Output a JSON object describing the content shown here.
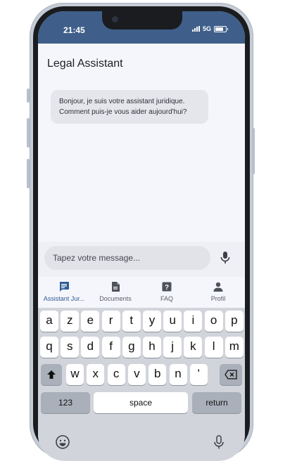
{
  "status_bar": {
    "time": "21:45",
    "network": "5G"
  },
  "app": {
    "title": "Legal Assistant"
  },
  "chat": {
    "messages": [
      {
        "sender": "assistant",
        "text": "Bonjour, je suis votre assistant juridique. Comment puis-je vous aider aujourd'hui?"
      }
    ]
  },
  "composer": {
    "placeholder": "Tapez votre message...",
    "mic_icon": "microphone-icon"
  },
  "bottom_nav": {
    "items": [
      {
        "label": "Assistant Jur...",
        "icon": "chat-icon",
        "active": true
      },
      {
        "label": "Documents",
        "icon": "document-icon",
        "active": false
      },
      {
        "label": "FAQ",
        "icon": "help-icon",
        "active": false
      },
      {
        "label": "Profil",
        "icon": "person-icon",
        "active": false
      }
    ]
  },
  "keyboard": {
    "row1": [
      "a",
      "z",
      "e",
      "r",
      "t",
      "y",
      "u",
      "i",
      "o",
      "p"
    ],
    "row2": [
      "q",
      "s",
      "d",
      "f",
      "g",
      "h",
      "j",
      "k",
      "l",
      "m"
    ],
    "row3": [
      "w",
      "x",
      "c",
      "v",
      "b",
      "n",
      "'"
    ],
    "numbers_label": "123",
    "space_label": "space",
    "return_label": "return"
  },
  "colors": {
    "header": "#3f5f8a",
    "accent": "#2f5c96",
    "bubble": "#e5e6eb"
  }
}
